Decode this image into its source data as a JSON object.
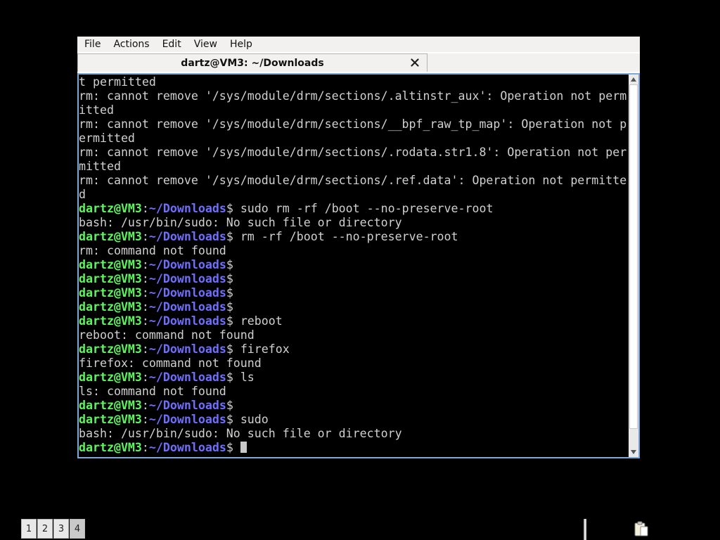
{
  "menubar": {
    "items": [
      "File",
      "Actions",
      "Edit",
      "View",
      "Help"
    ]
  },
  "tab": {
    "title": "dartz@VM3: ~/Downloads",
    "close_glyph": "✕"
  },
  "prompt": {
    "user": "dartz@VM3",
    "colon": ":",
    "path": "~/Downloads",
    "symbol": "$"
  },
  "terminal": {
    "lines": [
      {
        "type": "output",
        "text": "t permitted"
      },
      {
        "type": "output",
        "text": "rm: cannot remove '/sys/module/drm/sections/.altinstr_aux': Operation not perm"
      },
      {
        "type": "output",
        "text": "itted"
      },
      {
        "type": "output",
        "text": "rm: cannot remove '/sys/module/drm/sections/__bpf_raw_tp_map': Operation not p"
      },
      {
        "type": "output",
        "text": "ermitted"
      },
      {
        "type": "output",
        "text": "rm: cannot remove '/sys/module/drm/sections/.rodata.str1.8': Operation not per"
      },
      {
        "type": "output",
        "text": "mitted"
      },
      {
        "type": "output",
        "text": "rm: cannot remove '/sys/module/drm/sections/.ref.data': Operation not permitte"
      },
      {
        "type": "output",
        "text": "d"
      },
      {
        "type": "prompt",
        "command": " sudo rm -rf /boot --no-preserve-root"
      },
      {
        "type": "output",
        "text": "bash: /usr/bin/sudo: No such file or directory"
      },
      {
        "type": "prompt",
        "command": " rm -rf /boot --no-preserve-root"
      },
      {
        "type": "output",
        "text": "rm: command not found"
      },
      {
        "type": "prompt",
        "command": ""
      },
      {
        "type": "prompt",
        "command": ""
      },
      {
        "type": "prompt",
        "command": ""
      },
      {
        "type": "prompt",
        "command": ""
      },
      {
        "type": "prompt",
        "command": " reboot"
      },
      {
        "type": "output",
        "text": "reboot: command not found"
      },
      {
        "type": "prompt",
        "command": " firefox"
      },
      {
        "type": "output",
        "text": "firefox: command not found"
      },
      {
        "type": "prompt",
        "command": " ls"
      },
      {
        "type": "output",
        "text": "ls: command not found"
      },
      {
        "type": "prompt",
        "command": ""
      },
      {
        "type": "prompt",
        "command": " sudo"
      },
      {
        "type": "output",
        "text": "bash: /usr/bin/sudo: No such file or directory"
      },
      {
        "type": "prompt",
        "command": " ",
        "cursor": true
      }
    ]
  },
  "pager": {
    "desktops": [
      "1",
      "2",
      "3",
      "4"
    ],
    "active_index": 3
  },
  "icons": {
    "close": "close-icon",
    "scroll_up": "scroll-up-arrow-icon",
    "scroll_down": "scroll-down-arrow-icon",
    "tray": "clipboard-icon"
  },
  "colors": {
    "terminal_bg": "#000000",
    "prompt_user": "#5ff55f",
    "prompt_path": "#6f6fff",
    "output_text": "#d0d0d0",
    "terminal_border": "#7fa8d8"
  }
}
